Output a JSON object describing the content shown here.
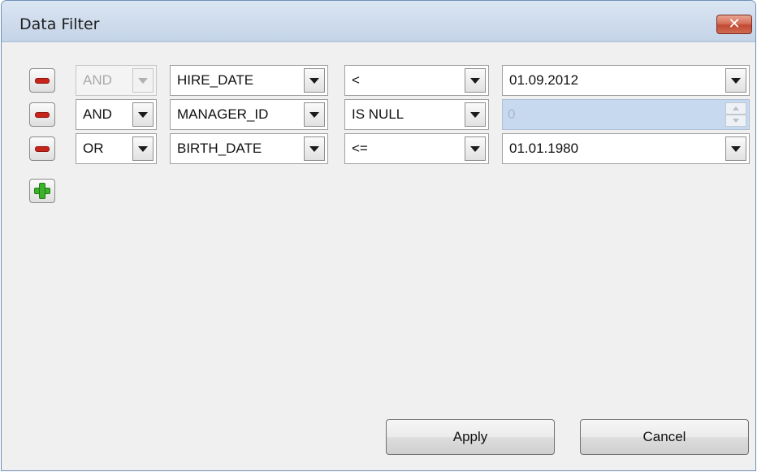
{
  "window": {
    "title": "Data Filter",
    "close_glyph": "✕"
  },
  "conditions": [
    {
      "logic": "AND",
      "logic_disabled": true,
      "field": "HIRE_DATE",
      "operator": "<",
      "value": "01.09.2012",
      "value_type": "combo"
    },
    {
      "logic": "AND",
      "logic_disabled": false,
      "field": "MANAGER_ID",
      "operator": "IS NULL",
      "value": "0",
      "value_type": "spin-disabled"
    },
    {
      "logic": "OR",
      "logic_disabled": false,
      "field": "BIRTH_DATE",
      "operator": "<=",
      "value": "01.01.1980",
      "value_type": "combo"
    }
  ],
  "buttons": {
    "apply": "Apply",
    "cancel": "Cancel"
  },
  "icons": {
    "remove": "minus-icon",
    "add": "plus-icon",
    "dropdown": "chevron-down-icon",
    "close": "close-icon"
  },
  "colors": {
    "remove_icon": "#c8241b",
    "add_icon": "#3cb12a",
    "close_button": "#c9533d",
    "disabled_value_bg": "#c6d9ef"
  }
}
